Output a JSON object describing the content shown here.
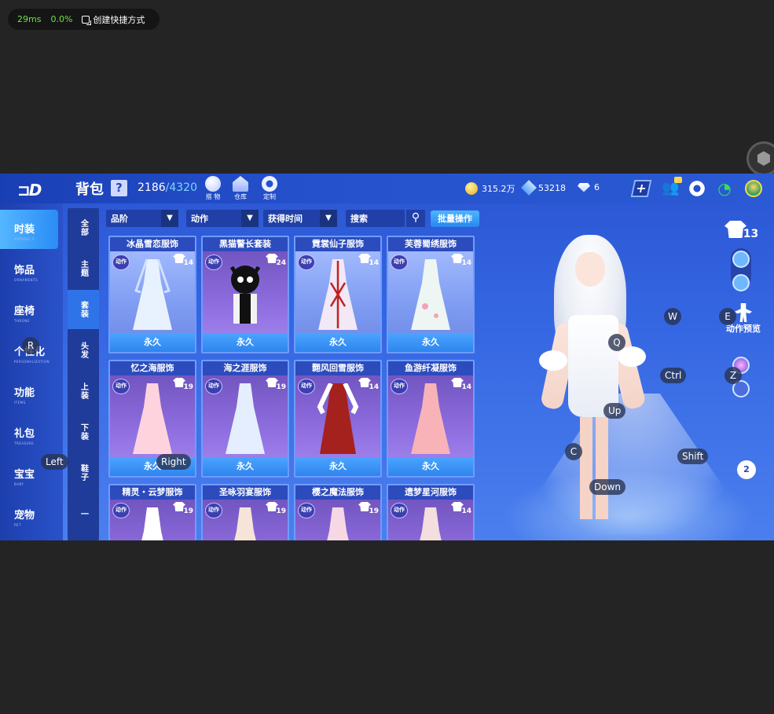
{
  "status_pill": {
    "latency": "29ms",
    "percent": "0.0%",
    "shortcut_label": "创建快捷方式"
  },
  "header": {
    "title": "背包",
    "help": "?",
    "capacity_used": "2186",
    "capacity_max": "/4320",
    "buttons": [
      {
        "label": "搭 物",
        "icon": "gem-icon"
      },
      {
        "label": "仓库",
        "icon": "warehouse-icon"
      },
      {
        "label": "定制",
        "icon": "customize-icon"
      }
    ],
    "gold": "315.2万",
    "crystals": "53218",
    "diamonds": "6"
  },
  "left_nav": [
    {
      "label": "时装",
      "sub": "APPAREL S"
    },
    {
      "label": "饰品",
      "sub": "ORNAMENTS"
    },
    {
      "label": "座椅",
      "sub": "THRONE"
    },
    {
      "label": "个性化",
      "sub": "PERSONALIZATION"
    },
    {
      "label": "功能",
      "sub": "ITEMS"
    },
    {
      "label": "礼包",
      "sub": "TREASURE"
    },
    {
      "label": "宝宝",
      "sub": "BABY"
    },
    {
      "label": "宠物",
      "sub": "PET"
    }
  ],
  "sub_nav": [
    "全部",
    "主题",
    "套装",
    "头发",
    "上装",
    "下装",
    "鞋子",
    "一"
  ],
  "filters": {
    "quality": "品阶",
    "action": "动作",
    "time": "获得时间",
    "search_placeholder": "搜索",
    "batch": "批量操作"
  },
  "items": [
    {
      "name": "冰晶雪恋服饰",
      "tag": "动作",
      "level": "14",
      "duration": "永久"
    },
    {
      "name": "黑猫警长套装",
      "tag": "动作",
      "level": "24",
      "duration": "永久"
    },
    {
      "name": "霓裳仙子服饰",
      "tag": "动作",
      "level": "14",
      "duration": "永久"
    },
    {
      "name": "芙蓉蜀绣服饰",
      "tag": "动作",
      "level": "14",
      "duration": "永久"
    },
    {
      "name": "忆之海服饰",
      "tag": "动作",
      "level": "19",
      "duration": "永久"
    },
    {
      "name": "海之涯服饰",
      "tag": "动作",
      "level": "19",
      "duration": "永久"
    },
    {
      "name": "翾风回雪服饰",
      "tag": "动作",
      "level": "14",
      "duration": "永久"
    },
    {
      "name": "鱼游纤凝服饰",
      "tag": "动作",
      "level": "14",
      "duration": "永久"
    },
    {
      "name": "精灵・云梦服饰",
      "tag": "动作",
      "level": "19",
      "duration": ""
    },
    {
      "name": "圣咏羽宴服饰",
      "tag": "动作",
      "level": "19",
      "duration": ""
    },
    {
      "name": "樱之魔法服饰",
      "tag": "动作",
      "level": "19",
      "duration": ""
    },
    {
      "name": "遗梦星河服饰",
      "tag": "动作",
      "level": "14",
      "duration": ""
    }
  ],
  "right_panel": {
    "outfit_count": "113",
    "action_preview": "动作预览",
    "outfit_slot": "2"
  },
  "key_overlays": {
    "R": "R",
    "Left": "Left",
    "Right": "Right",
    "W": "W",
    "E": "E",
    "Q": "Q",
    "Ctrl": "Ctrl",
    "Z": "Z",
    "Up": "Up",
    "C": "C",
    "Shift": "Shift",
    "Down": "Down"
  },
  "colors": {
    "accent": "#2f73e8",
    "latency": "#6ee14b",
    "capacity_max": "#7fd3ff"
  }
}
